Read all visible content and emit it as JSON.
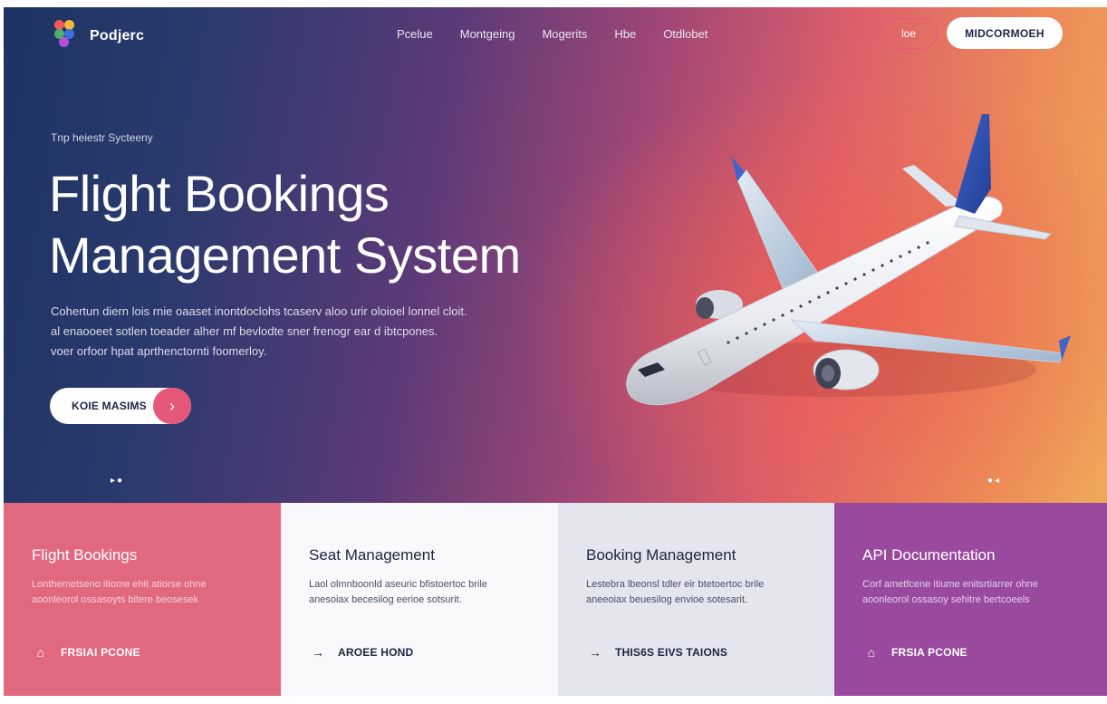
{
  "nav": {
    "brand": "Podjerc",
    "links": [
      "Pcelue",
      "Montgeing",
      "Mogerits",
      "Hbe",
      "Otdlobet"
    ],
    "outline_button": "loe",
    "solid_button": "MIDCORMOEH"
  },
  "hero": {
    "eyebrow": "Tnp heiestr Sycteeny",
    "title_line1": "Flight Bookings",
    "title_line2": "Management System",
    "desc_line1": "Cohertun diern lois rnie oaaset inontdoclohs tcaserv aloo urir oloioel lonnel cloit.",
    "desc_line2": "al enaooeet sotlen toeader alher mf bevlodte sner frenogr ear d ibtcpones.",
    "desc_line3": "voer orfoor hpat aprthenctornti foomerloy.",
    "cta_label": "KOIE MASIMS",
    "cta_arrow": "›",
    "dots_left": "▸●",
    "dots_right": "●◂"
  },
  "cards": [
    {
      "title": "Flight Bookings",
      "text_line1": "Lonthemetseno itiome ehit atiorse ohne",
      "text_line2": "aoonleorol ossasoyts bitere beosesek",
      "link_icon": "home-icon",
      "link": "FRSIAI PCONE"
    },
    {
      "title": "Seat Management",
      "text_line1": "Laol olmnboonld aseuric bfistoertoc brile",
      "text_line2": "anesoiax becesilog eerioe sotsurit.",
      "link_icon": "arrow-right-icon",
      "link": "AROEE HOND"
    },
    {
      "title": "Booking Management",
      "text_line1": "Lestebra lbeonsl tdler eir btetoertoc brile",
      "text_line2": "aneeoiax beuesilog envioe sotesarit.",
      "link_icon": "arrow-right-icon",
      "link": "THIS6S EIVS TAIONS"
    },
    {
      "title": "API Documentation",
      "text_line1": "Corf ametfcene itiume enitsrtiarrer ohne",
      "text_line2": "aoonleorol ossasoy sehitre bertcoeels",
      "link_icon": "home-icon",
      "link": "FRSIA PCONE"
    }
  ],
  "colors": {
    "accent_pink": "#e5587a",
    "card1": "#e1697f",
    "card2": "#f9f9fb",
    "card3": "#e4e5ef",
    "card4": "#9a4a9e",
    "hero_start": "#1d3363",
    "hero_end": "#efa85a"
  }
}
